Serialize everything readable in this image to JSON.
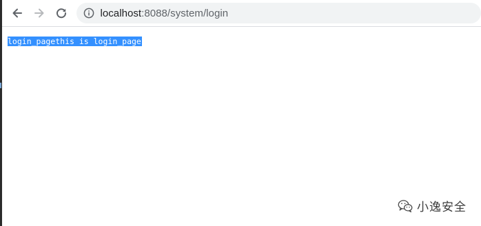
{
  "browser": {
    "url_host": "localhost",
    "url_path": ":8088/system/login"
  },
  "page": {
    "body_text": "login_pagethis is login_page"
  },
  "watermark": {
    "text": "小逸安全"
  },
  "icons": {
    "back": "back-arrow-icon",
    "forward": "forward-arrow-icon",
    "reload": "reload-icon",
    "site_info": "info-icon",
    "watermark_logo": "wechat-icon"
  },
  "colors": {
    "selection": "#3390ff",
    "omnibox_bg": "#f1f3f4"
  }
}
